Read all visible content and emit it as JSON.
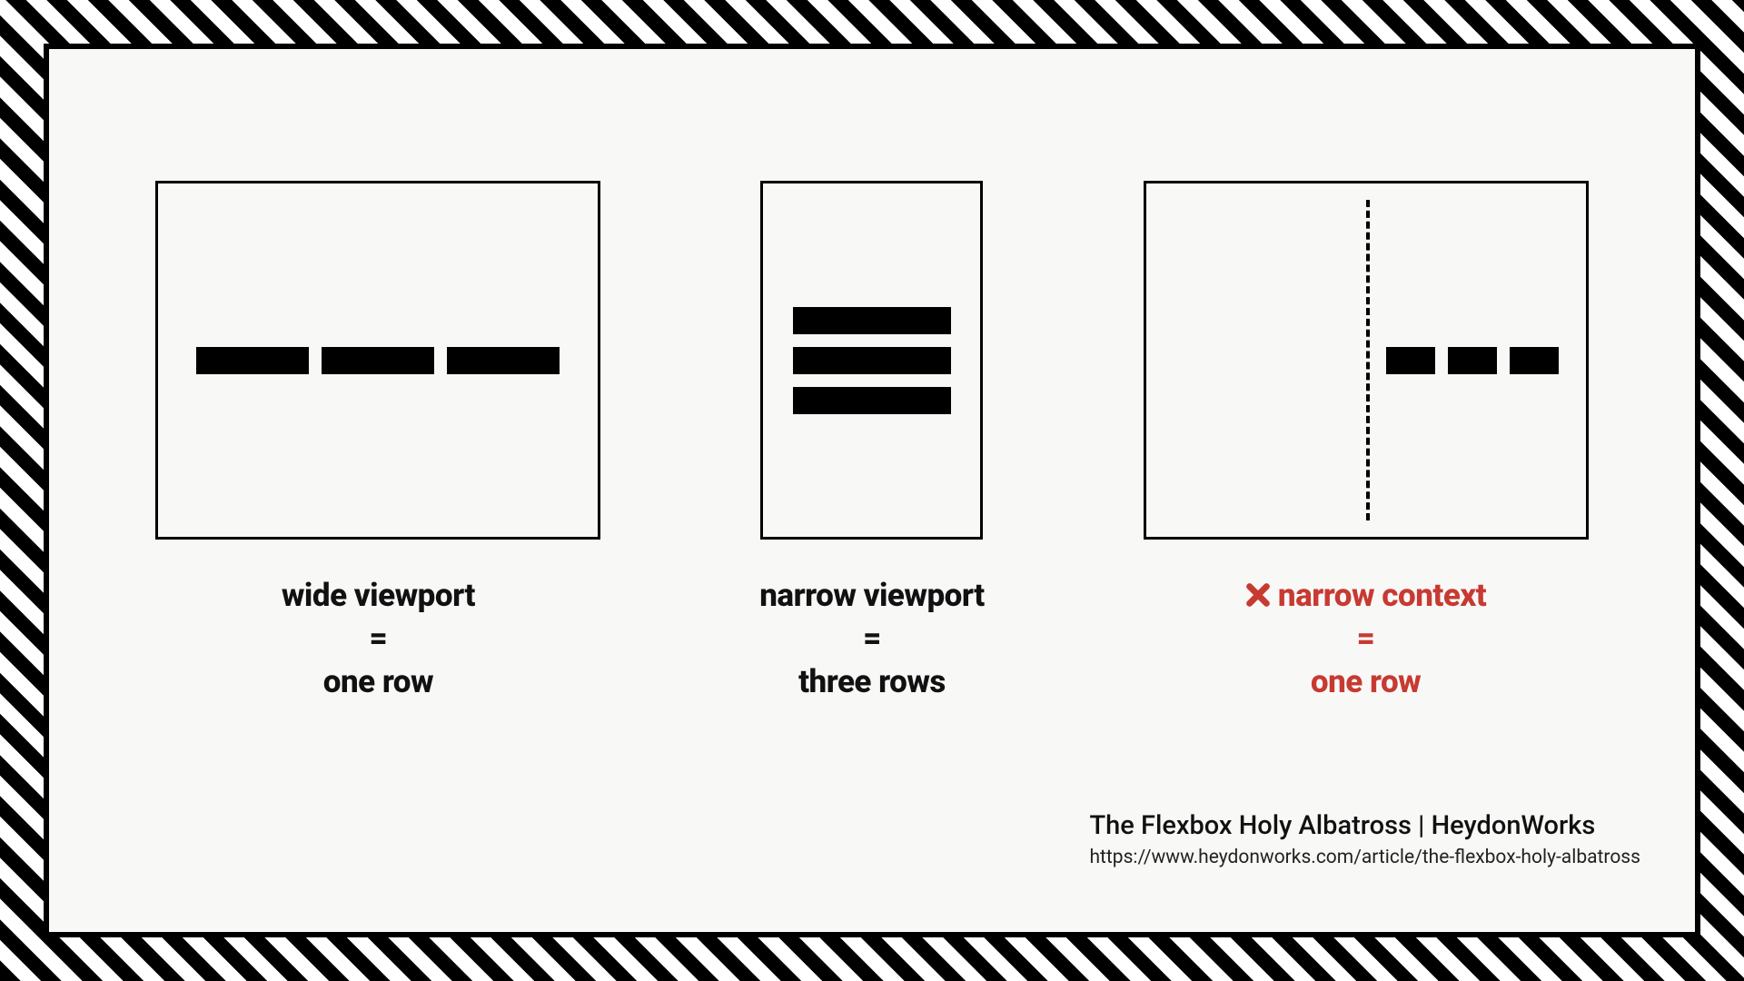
{
  "captions": {
    "wide": {
      "l1": "wide viewport",
      "eq": "=",
      "l2": "one row"
    },
    "narrow": {
      "l1": "narrow viewport",
      "eq": "=",
      "l2": "three rows"
    },
    "context": {
      "l1": "narrow context",
      "eq": "=",
      "l2": "one row"
    }
  },
  "credit": {
    "title": "The Flexbox Holy Albatross | HeydonWorks",
    "url": "https://www.heydonworks.com/article/the-flexbox-holy-albatross"
  },
  "colors": {
    "error": "#c73a32"
  }
}
